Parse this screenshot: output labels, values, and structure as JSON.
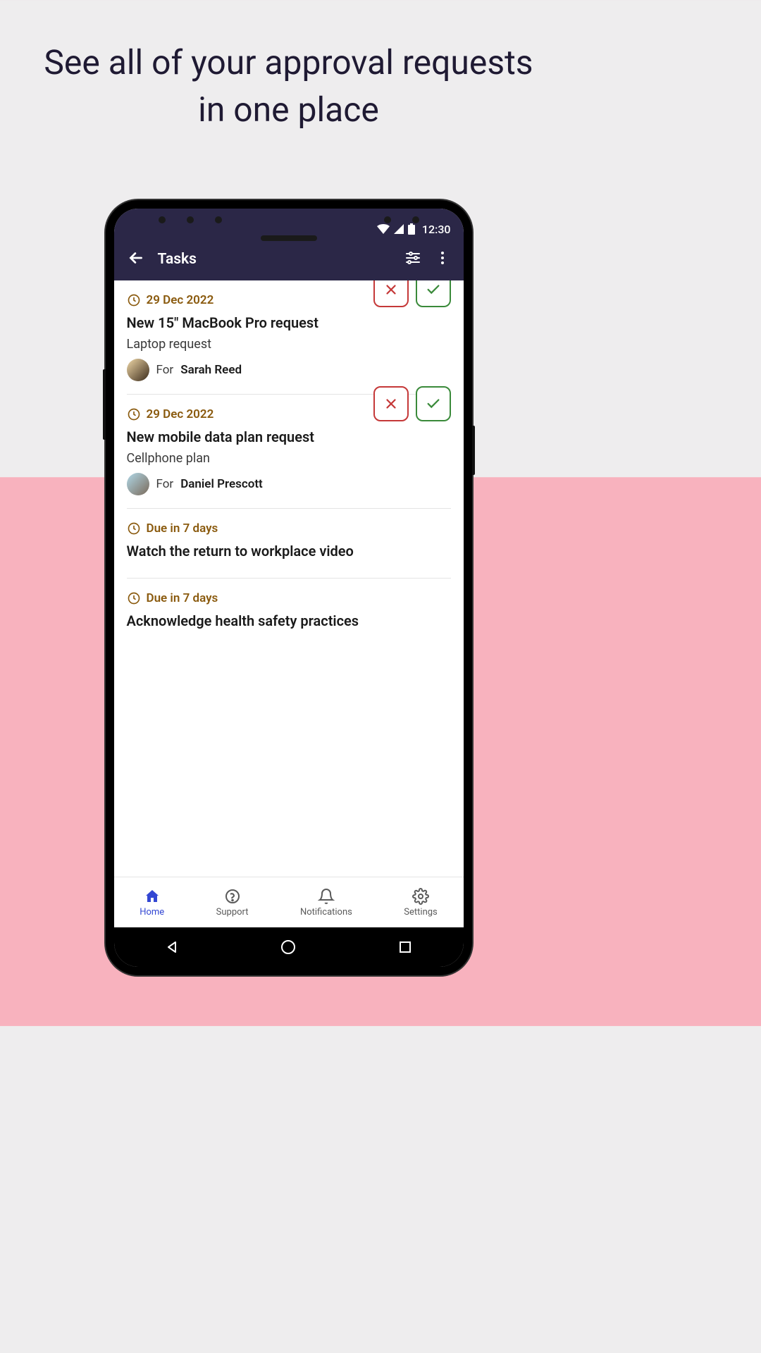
{
  "headline": "See all of your approval requests in one place",
  "status": {
    "time": "12:30"
  },
  "appbar": {
    "title": "Tasks"
  },
  "tasks": [
    {
      "date": "29 Dec 2022",
      "title": "New 15\" MacBook Pro request",
      "subtitle": "Laptop request",
      "for_label": "For",
      "person": "Sarah Reed",
      "has_actions": true,
      "avatar": "sarah"
    },
    {
      "date": "29 Dec 2022",
      "title": "New mobile data plan request",
      "subtitle": "Cellphone plan",
      "for_label": "For",
      "person": "Daniel Prescott",
      "has_actions": true,
      "avatar": "daniel"
    },
    {
      "date": "Due in 7 days",
      "title": "Watch the return to workplace video",
      "has_actions": false
    },
    {
      "date": "Due in 7 days",
      "title": "Acknowledge health safety practices",
      "has_actions": false
    }
  ],
  "nav": {
    "home": "Home",
    "support": "Support",
    "notifications": "Notifications",
    "settings": "Settings"
  }
}
